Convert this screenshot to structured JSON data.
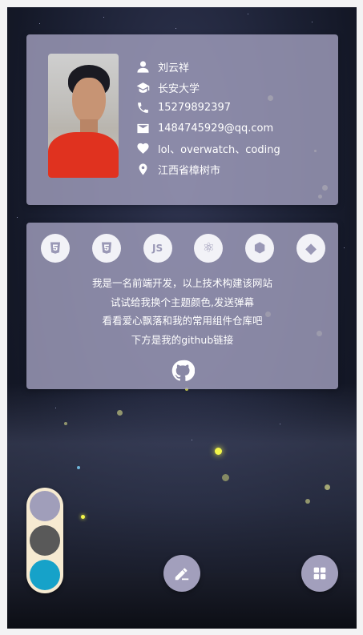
{
  "profile": {
    "name": "刘云祥",
    "school": "长安大学",
    "phone": "15279892397",
    "email": "1484745929@qq.com",
    "hobbies": "lol、overwatch、coding",
    "location": "江西省樟树市"
  },
  "tech_icons": [
    {
      "name": "html5-icon",
      "glyph": "5"
    },
    {
      "name": "css3-icon",
      "glyph": "3"
    },
    {
      "name": "javascript-icon",
      "glyph": "JS"
    },
    {
      "name": "react-icon",
      "glyph": "⚛"
    },
    {
      "name": "webpack-icon",
      "glyph": "⬢"
    },
    {
      "name": "git-icon",
      "glyph": "◆"
    }
  ],
  "intro": {
    "line1": "我是一名前端开发，以上技术构建该网站",
    "line2": "试试给我换个主题颜色,发送弹幕",
    "line3": "看看爱心飘落和我的常用组件仓库吧",
    "line4": "下方是我的github链接"
  },
  "theme_colors": [
    "#a09eba",
    "#595959",
    "#16a2c9"
  ],
  "colors": {
    "card": "#a09ebc",
    "palette_bg": "#f6ead1",
    "fab": "#a29fbc"
  }
}
